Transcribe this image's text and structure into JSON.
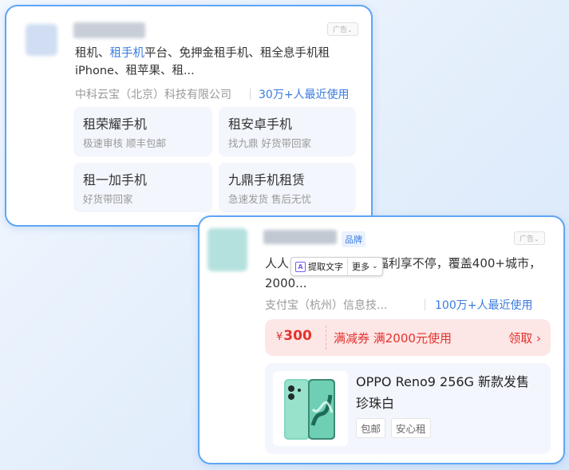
{
  "ad1": {
    "ad_tag": "广告",
    "description_parts": [
      "租机、",
      "租手机",
      "平台、免押金租手机、租全息手机租iPhone、租苹果、租..."
    ],
    "company": "中科云宝（北京）科技有限公司",
    "recent": "30万+人最近使用",
    "sub_links": [
      {
        "title": "租荣耀手机",
        "subtitle": "极速审核 顺丰包邮"
      },
      {
        "title": "租安卓手机",
        "subtitle": "找九鼎 好货带回家"
      },
      {
        "title": "租一加手机",
        "subtitle": "好货带回家"
      },
      {
        "title": "九鼎手机租赁",
        "subtitle": "急速发货 售后无忧"
      }
    ]
  },
  "ad2": {
    "badge": "品牌",
    "ad_tag": "广告",
    "description": "人人 全网比价，优惠福利享不停，覆盖400+城市，2000...",
    "company": "支付宝（杭州）信息技...",
    "recent": "100万+人最近使用",
    "coupon": {
      "currency": "¥",
      "amount": "300",
      "description": "满减券 满2000元使用",
      "claim": "领取",
      "claim_arrow": "›"
    },
    "product": {
      "title": "OPPO Reno9 256G 新款发售 珍珠白",
      "tags": [
        "包邮",
        "安心租"
      ]
    }
  },
  "toolbar": {
    "extract_label": "提取文字",
    "more_label": "更多"
  },
  "colors": {
    "card_border": "#5ea6f4",
    "link_blue": "#3a7be0",
    "coupon_red": "#e5322d",
    "coupon_bg": "#fde6e6",
    "product_phone": "#6fcfb4"
  }
}
